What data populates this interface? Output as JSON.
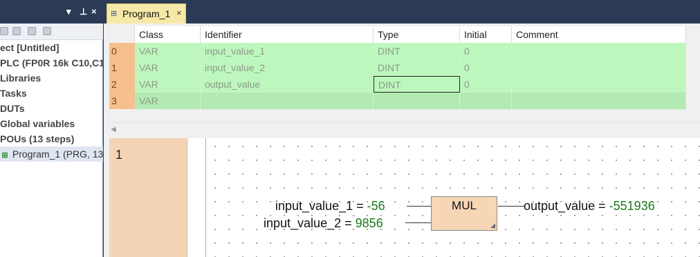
{
  "window_controls": {
    "dropdown": "▾",
    "pin": "ꟷ",
    "close": "×"
  },
  "project_tree": {
    "items": [
      {
        "label": "ect [Untitled]",
        "bold": true
      },
      {
        "label": "PLC (FP0R 16k C10,C1",
        "bold": true
      },
      {
        "label": "Libraries",
        "bold": true
      },
      {
        "label": "Tasks",
        "bold": true
      },
      {
        "label": "DUTs",
        "bold": true
      },
      {
        "label": "Global variables",
        "bold": true
      },
      {
        "label": "POUs (13 steps)",
        "bold": true
      },
      {
        "label": "Program_1 (PRG, 13",
        "bold": false
      }
    ]
  },
  "editor_tab": {
    "label": "Program_1",
    "close": "×"
  },
  "variable_table": {
    "columns": [
      "Class",
      "Identifier",
      "Type",
      "Initial",
      "Comment"
    ],
    "rows": [
      {
        "num": "0",
        "class": "VAR",
        "identifier": "input_value_1",
        "type": "DINT",
        "initial": "0",
        "comment": ""
      },
      {
        "num": "1",
        "class": "VAR",
        "identifier": "input_value_2",
        "type": "DINT",
        "initial": "0",
        "comment": ""
      },
      {
        "num": "2",
        "class": "VAR",
        "identifier": "output_value",
        "type": "DINT",
        "initial": "0",
        "comment": ""
      },
      {
        "num": "3",
        "class": "VAR",
        "identifier": "",
        "type": "",
        "initial": "",
        "comment": ""
      }
    ],
    "scroll_left": "◀"
  },
  "ladder": {
    "rung_number": "1",
    "input1": {
      "name": "input_value_1",
      "eq": "=",
      "value": "-56"
    },
    "input2": {
      "name": "input_value_2",
      "eq": "=",
      "value": "9856"
    },
    "output": {
      "name": "output_value",
      "eq": "=",
      "value": "-551936"
    },
    "function_block": "MUL"
  }
}
